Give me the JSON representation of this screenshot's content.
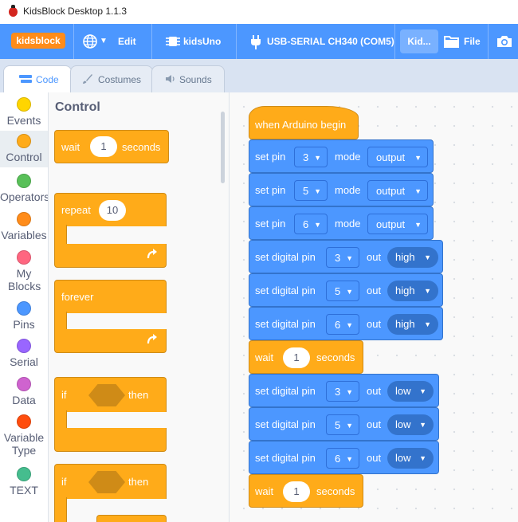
{
  "app": {
    "title": "KidsBlock Desktop 1.1.3"
  },
  "menubar": {
    "logo": "kidsblock",
    "language_icon": "globe-icon",
    "edit_label": "Edit",
    "board_label": "kidsUno",
    "port_label": "USB-SERIAL CH340 (COM5)",
    "project_label": "Kid...",
    "file_label": "File",
    "colors": {
      "bar": "#4c97ff",
      "logo": "#ff8c1a"
    }
  },
  "tabs": [
    {
      "label": "Code",
      "icon": "code-icon",
      "active": true
    },
    {
      "label": "Costumes",
      "icon": "brush-icon",
      "active": false
    },
    {
      "label": "Sounds",
      "icon": "speaker-icon",
      "active": false
    }
  ],
  "categories": [
    {
      "label": "Events",
      "color": "#ffd500"
    },
    {
      "label": "Control",
      "color": "#ffab19",
      "selected": true
    },
    {
      "label": "Operators",
      "color": "#59c059"
    },
    {
      "label": "Variables",
      "color": "#ff8c1a"
    },
    {
      "label": "My Blocks",
      "color": "#ff6680"
    },
    {
      "label": "Pins",
      "color": "#4c97ff"
    },
    {
      "label": "Serial",
      "color": "#9966ff"
    },
    {
      "label": "Data",
      "color": "#cf63cf"
    },
    {
      "label": "Variable Type",
      "color": "#ff4d0d"
    },
    {
      "label": "TEXT",
      "color": "#45bd8e"
    }
  ],
  "flyout": {
    "heading": "Control",
    "wait": {
      "label": "wait",
      "value": "1",
      "unit": "seconds"
    },
    "repeat": {
      "label": "repeat",
      "value": "10"
    },
    "forever": {
      "label": "forever"
    },
    "if1": {
      "label": "if",
      "then": "then"
    },
    "if2": {
      "label": "if",
      "then": "then"
    }
  },
  "script": {
    "hat": "when Arduino begin",
    "mode_blocks": [
      {
        "label": "set pin",
        "pin": "3",
        "mode_label": "mode",
        "mode": "output"
      },
      {
        "label": "set pin",
        "pin": "5",
        "mode_label": "mode",
        "mode": "output"
      },
      {
        "label": "set pin",
        "pin": "6",
        "mode_label": "mode",
        "mode": "output"
      }
    ],
    "high_blocks": [
      {
        "label": "set digital pin",
        "pin": "3",
        "out_label": "out",
        "level": "high"
      },
      {
        "label": "set digital pin",
        "pin": "5",
        "out_label": "out",
        "level": "high"
      },
      {
        "label": "set digital pin",
        "pin": "6",
        "out_label": "out",
        "level": "high"
      }
    ],
    "wait1": {
      "label": "wait",
      "value": "1",
      "unit": "seconds"
    },
    "low_blocks": [
      {
        "label": "set digital pin",
        "pin": "3",
        "out_label": "out",
        "level": "low"
      },
      {
        "label": "set digital pin",
        "pin": "5",
        "out_label": "out",
        "level": "low"
      },
      {
        "label": "set digital pin",
        "pin": "6",
        "out_label": "out",
        "level": "low"
      }
    ],
    "wait2": {
      "label": "wait",
      "value": "1",
      "unit": "seconds"
    }
  }
}
